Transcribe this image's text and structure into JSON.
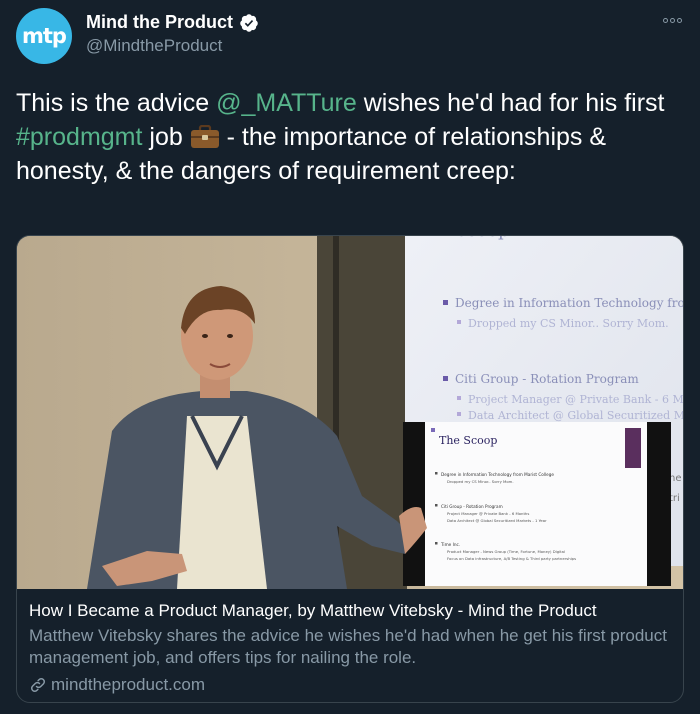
{
  "author": {
    "avatar_text": "mtp",
    "display_name": "Mind the Product",
    "handle": "@MindtheProduct"
  },
  "tweet": {
    "text_1": "This is the advice ",
    "mention": "@_MATTure",
    "text_2": " wishes he'd had for his first ",
    "hashtag": "#prodmgmt",
    "text_3": " job ",
    "text_4": " - the importance of relationships & honesty, & the dangers of requirement creep:"
  },
  "slide": {
    "line1": "Degree in Information Technology fro",
    "line2": "Dropped my CS Minor.. Sorry Mom.",
    "line3": "Citi Group - Rotation Program",
    "line4": "Project Manager @ Private Bank - 6 Mo",
    "line5": "Data Architect @ Global Securitized M",
    "inset_title": "The Scoop",
    "inset_1": "Degree in Information Technology from Marist College",
    "inset_2": "Dropped my CS Minor.. Sorry Mom.",
    "inset_3": "Citi Group - Rotation Program",
    "inset_4": "Project Manager @ Private Bank - 6 Months",
    "inset_5": "Data Architect @ Global Securitized Markets - 1 Year",
    "inset_6": "Time Inc.",
    "inset_7": "Product Manager - News Group (Time, Fortune, Money) Digital",
    "inset_8": "Focus on Data infrastructure, A/B Testing & Third party partnerships",
    "edge_1": "ne",
    "edge_2": "tri"
  },
  "card": {
    "title": "How I Became a Product Manager, by Matthew Vitebsky - Mind the Product",
    "description": "Matthew Vitebsky shares the advice he wishes he'd had when he get his first product management job, and offers tips for nailing the role.",
    "domain": "mindtheproduct.com"
  },
  "colors": {
    "background": "#15202b",
    "link": "#57b48b",
    "secondary_text": "#8899a6",
    "avatar": "#38b7e6"
  },
  "icons": [
    "verified-badge-icon",
    "more-options-icon",
    "briefcase-emoji-icon",
    "link-icon"
  ]
}
